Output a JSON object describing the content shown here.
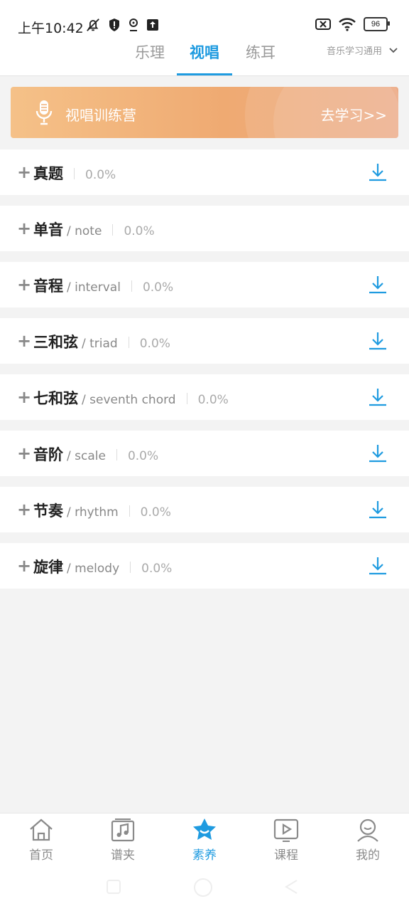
{
  "status": {
    "time": "上午10:42",
    "battery": "96"
  },
  "tabs": [
    {
      "label": "乐理",
      "active": false
    },
    {
      "label": "视唱",
      "active": true
    },
    {
      "label": "练耳",
      "active": false
    }
  ],
  "selector": {
    "label": "音乐学习通用"
  },
  "banner": {
    "title": "视唱训练营",
    "cta": "去学习>>"
  },
  "list": [
    {
      "title": "真题",
      "sub": "",
      "pct": "0.0%",
      "download": true
    },
    {
      "title": "单音",
      "sub": "/ note",
      "pct": "0.0%",
      "download": false
    },
    {
      "title": "音程",
      "sub": "/ interval",
      "pct": "0.0%",
      "download": true
    },
    {
      "title": "三和弦",
      "sub": "/ triad",
      "pct": "0.0%",
      "download": true
    },
    {
      "title": "七和弦",
      "sub": "/ seventh chord",
      "pct": "0.0%",
      "download": true
    },
    {
      "title": "音阶",
      "sub": "/ scale",
      "pct": "0.0%",
      "download": true
    },
    {
      "title": "节奏",
      "sub": "/ rhythm",
      "pct": "0.0%",
      "download": true
    },
    {
      "title": "旋律",
      "sub": "/ melody",
      "pct": "0.0%",
      "download": true
    }
  ],
  "nav": [
    {
      "label": "首页",
      "icon": "home-icon",
      "active": false
    },
    {
      "label": "谱夹",
      "icon": "music-folder-icon",
      "active": false
    },
    {
      "label": "素养",
      "icon": "star-icon",
      "active": true
    },
    {
      "label": "课程",
      "icon": "play-video-icon",
      "active": false
    },
    {
      "label": "我的",
      "icon": "user-icon",
      "active": false
    }
  ],
  "colors": {
    "accent": "#1f9be0",
    "banner_start": "#f5c188",
    "banner_end": "#ecaa85"
  }
}
